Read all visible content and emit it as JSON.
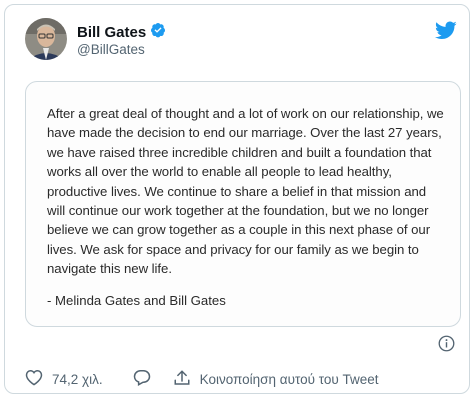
{
  "author": {
    "name": "Bill Gates",
    "handle": "@BillGates",
    "verified": true,
    "avatar_icon": "avatar-portrait"
  },
  "statement": {
    "body": "After a great deal of thought and a lot of work on our relationship, we have made the decision to end our marriage. Over the last 27 years, we have raised three incredible children and built a foundation that works all over the world to enable all people to lead healthy, productive lives. We continue to share a belief in that mission and will continue our work together at the foundation, but we no longer believe we can grow together as a couple in this next phase of our lives. We ask for space and privacy for our family as we begin to navigate this new life.",
    "signature": "- Melinda Gates and Bill Gates"
  },
  "actions": {
    "likes_count": "74,2 χιλ.",
    "share_label": "Κοινοποίηση αυτού του Tweet"
  },
  "colors": {
    "brand_blue": "#1d9bf0",
    "text_primary": "#0f1419",
    "text_secondary": "#536471",
    "border": "#cfd9de"
  },
  "icons": {
    "logo": "twitter-bird-icon",
    "verified": "verified-badge-icon",
    "info": "info-icon",
    "like": "heart-icon",
    "reply": "reply-bubble-icon",
    "share": "share-icon"
  }
}
